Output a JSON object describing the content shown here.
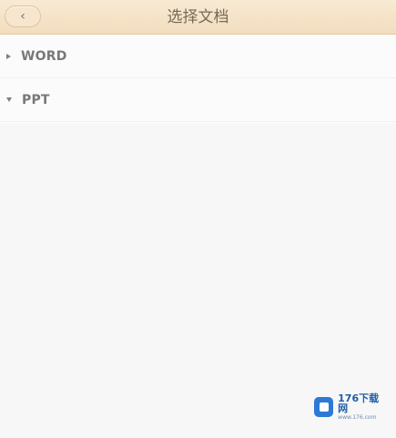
{
  "header": {
    "title": "选择文档",
    "back_label": "‹"
  },
  "document_types": [
    {
      "label": "WORD",
      "state": "collapsed"
    },
    {
      "label": "PPT",
      "state": "expanded"
    }
  ],
  "watermark": {
    "main_text": "176下载网",
    "sub_text": "www.176.com",
    "brand_color": "#2d7ad6"
  },
  "colors": {
    "header_bg": "#f2ddbe",
    "page_bg": "#f7f7f7",
    "title_text": "#756a58"
  },
  "icons": {
    "back": "chevron-left-icon",
    "word_toggle": "caret-right-icon",
    "ppt_toggle": "caret-down-icon"
  }
}
